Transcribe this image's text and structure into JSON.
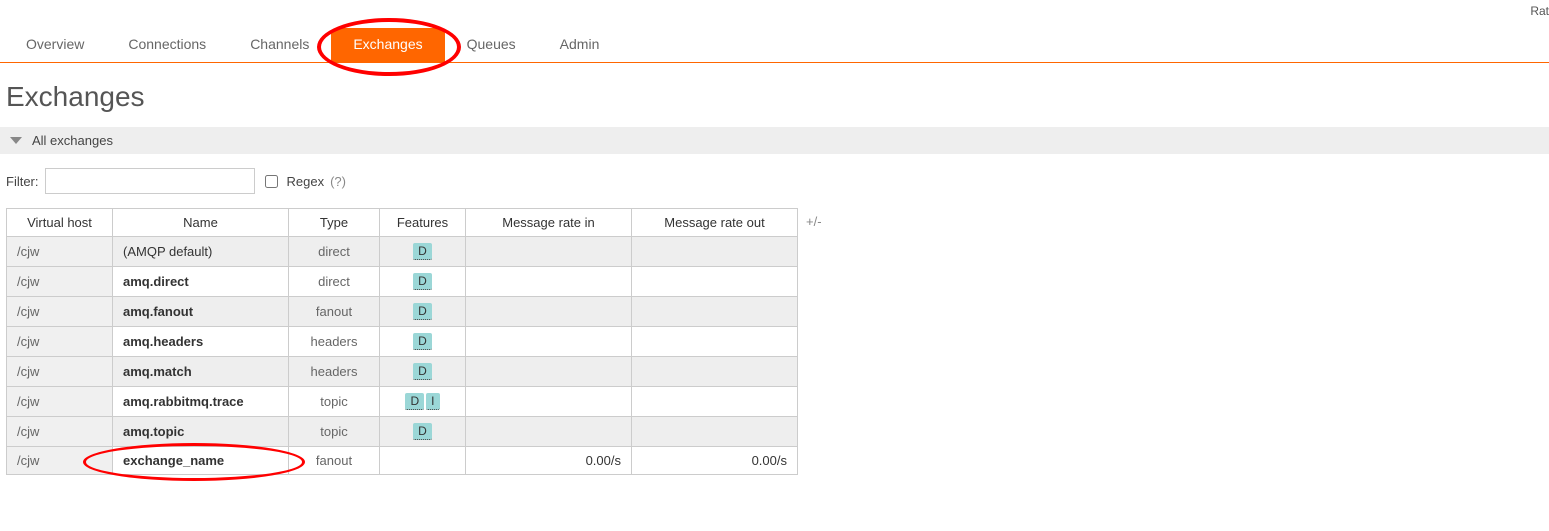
{
  "topright": "Rat",
  "tabs": [
    {
      "label": "Overview",
      "selected": false
    },
    {
      "label": "Connections",
      "selected": false
    },
    {
      "label": "Channels",
      "selected": false
    },
    {
      "label": "Exchanges",
      "selected": true
    },
    {
      "label": "Queues",
      "selected": false
    },
    {
      "label": "Admin",
      "selected": false
    }
  ],
  "page_title": "Exchanges",
  "section_title": "All exchanges",
  "filter": {
    "label": "Filter:",
    "value": "",
    "regex_label": "Regex",
    "regex_checked": false,
    "help": "(?)"
  },
  "columns": [
    "Virtual host",
    "Name",
    "Type",
    "Features",
    "Message rate in",
    "Message rate out"
  ],
  "plusminus": "+/-",
  "rows": [
    {
      "vhost": "/cjw",
      "name": "(AMQP default)",
      "default": true,
      "type": "direct",
      "features": [
        "D"
      ],
      "rate_in": "",
      "rate_out": "",
      "alt": true
    },
    {
      "vhost": "/cjw",
      "name": "amq.direct",
      "type": "direct",
      "features": [
        "D"
      ],
      "rate_in": "",
      "rate_out": "",
      "alt": false
    },
    {
      "vhost": "/cjw",
      "name": "amq.fanout",
      "type": "fanout",
      "features": [
        "D"
      ],
      "rate_in": "",
      "rate_out": "",
      "alt": true
    },
    {
      "vhost": "/cjw",
      "name": "amq.headers",
      "type": "headers",
      "features": [
        "D"
      ],
      "rate_in": "",
      "rate_out": "",
      "alt": false
    },
    {
      "vhost": "/cjw",
      "name": "amq.match",
      "type": "headers",
      "features": [
        "D"
      ],
      "rate_in": "",
      "rate_out": "",
      "alt": true
    },
    {
      "vhost": "/cjw",
      "name": "amq.rabbitmq.trace",
      "type": "topic",
      "features": [
        "D",
        "I"
      ],
      "rate_in": "",
      "rate_out": "",
      "alt": false
    },
    {
      "vhost": "/cjw",
      "name": "amq.topic",
      "type": "topic",
      "features": [
        "D"
      ],
      "rate_in": "",
      "rate_out": "",
      "alt": true
    },
    {
      "vhost": "/cjw",
      "name": "exchange_name",
      "type": "fanout",
      "features": [],
      "rate_in": "0.00/s",
      "rate_out": "0.00/s",
      "alt": false
    }
  ],
  "annotations": {
    "tab_ellipse_index": 3,
    "row_ellipse_index": 7
  }
}
